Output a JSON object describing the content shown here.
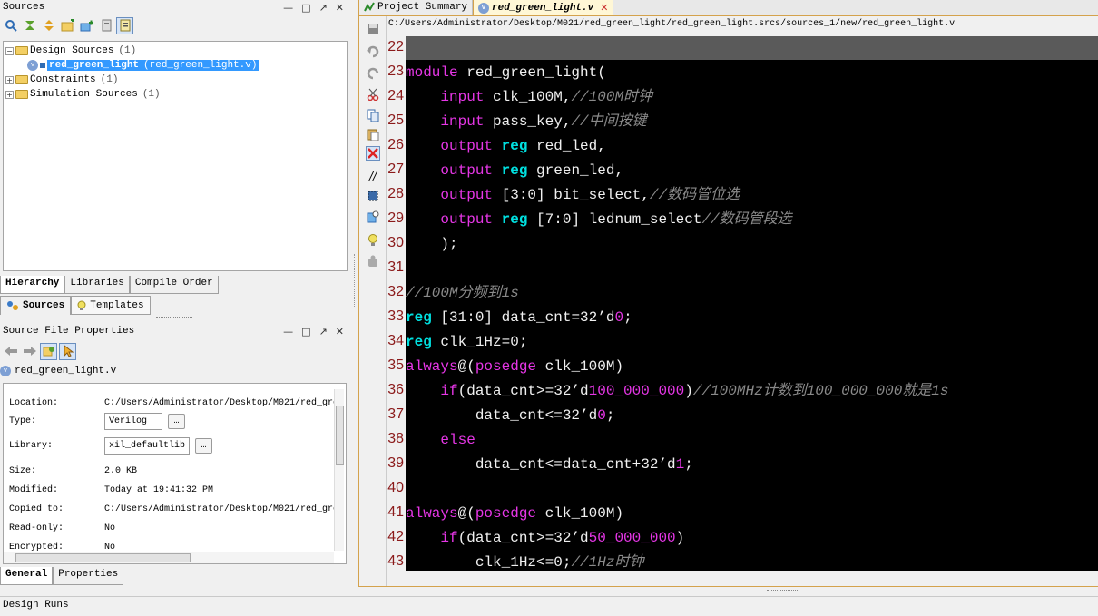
{
  "sources": {
    "title": "Sources",
    "tree": [
      {
        "label": "Design Sources",
        "count": "(1)"
      },
      {
        "label": "red_green_light",
        "file": "(red_green_light.v)"
      },
      {
        "label": "Constraints",
        "count": "(1)"
      },
      {
        "label": "Simulation Sources",
        "count": "(1)"
      }
    ],
    "view_tabs": [
      "Hierarchy",
      "Libraries",
      "Compile Order"
    ],
    "bottom_tabs": [
      "Sources",
      "Templates"
    ]
  },
  "props": {
    "title": "Source File Properties",
    "file": "red_green_light.v",
    "rows": [
      {
        "label": "Location:",
        "value": "C:/Users/Administrator/Desktop/M021/red_gre"
      },
      {
        "label": "Type:",
        "value": "Verilog"
      },
      {
        "label": "Library:",
        "value": "xil_defaultlib"
      },
      {
        "label": "Size:",
        "value": "2.0 KB"
      },
      {
        "label": "Modified:",
        "value": "Today at 19:41:32 PM"
      },
      {
        "label": "Copied to:",
        "value": "C:/Users/Administrator/Desktop/M021/red_gre"
      },
      {
        "label": "Read-only:",
        "value": "No"
      },
      {
        "label": "Encrypted:",
        "value": "No"
      }
    ],
    "tabs": [
      "General",
      "Properties"
    ]
  },
  "editor": {
    "tabs": [
      "Project Summary",
      "red_green_light.v"
    ],
    "path": "C:/Users/Administrator/Desktop/M021/red_green_light/red_green_light.srcs/sources_1/new/red_green_light.v",
    "line_numbers": [
      "22",
      "23",
      "24",
      "25",
      "26",
      "27",
      "28",
      "29",
      "30",
      "31",
      "32",
      "33",
      "34",
      "35",
      "36",
      "37",
      "38",
      "39",
      "40",
      "41",
      "42",
      "43"
    ],
    "code": {
      "l23": {
        "kw": "module",
        "rest": " red_green_light("
      },
      "l24": {
        "kw": "input",
        "rest": " clk_100M,",
        "cm": "//100M时钟"
      },
      "l25": {
        "kw": "input",
        "rest": " pass_key,",
        "cm": "//中间按键"
      },
      "l26": {
        "kw": "output",
        "kw2": "reg",
        "rest": " red_led,"
      },
      "l27": {
        "kw": "output",
        "kw2": "reg",
        "rest": " green_led,"
      },
      "l28": {
        "kw": "output",
        "rest": " [3:0] bit_select,",
        "cm": "//数码管位选"
      },
      "l29": {
        "kw": "output",
        "kw2": "reg",
        "rest": " [7:0] lednum_select",
        "cm": "//数码管段选"
      },
      "l30": {
        "rest": ");"
      },
      "l32": {
        "cm": "//100M分频到1s"
      },
      "l33": {
        "kw2": "reg",
        "rest": " [31:0] data_cnt=32’d",
        "num": "0",
        "tail": ";"
      },
      "l34": {
        "kw2": "reg",
        "rest": " clk_1Hz=0;"
      },
      "l35": {
        "kw": "always",
        "rest": "@(",
        "kw_b": "posedge",
        "tail": " clk_100M)"
      },
      "l36": {
        "kw": "if",
        "rest": "(data_cnt>=32’d",
        "num": "100_000_000",
        "tail": ")",
        "cm": "//100MHz计数到100_000_000就是1s"
      },
      "l37": {
        "rest": "data_cnt<=32’d",
        "num": "0",
        "tail": ";"
      },
      "l38": {
        "kw": "else"
      },
      "l39": {
        "rest": "data_cnt<=data_cnt+32’d",
        "num": "1",
        "tail": ";"
      },
      "l41": {
        "kw": "always",
        "rest": "@(",
        "kw_b": "posedge",
        "tail": " clk_100M)"
      },
      "l42": {
        "kw": "if",
        "rest": "(data_cnt>=32’d",
        "num": "50_000_000",
        "tail": ")"
      },
      "l43": {
        "rest": "clk_1Hz<=0;",
        "cm": "//1Hz时钟"
      }
    }
  },
  "bottom": {
    "design_runs": "Design Runs"
  },
  "colors": {
    "selection": "#3399ff",
    "keyword": "#e636e6",
    "type": "#00e0e0",
    "comment": "#8a8a8a",
    "editor_bg": "#000000",
    "accent": "#d4a24c"
  }
}
